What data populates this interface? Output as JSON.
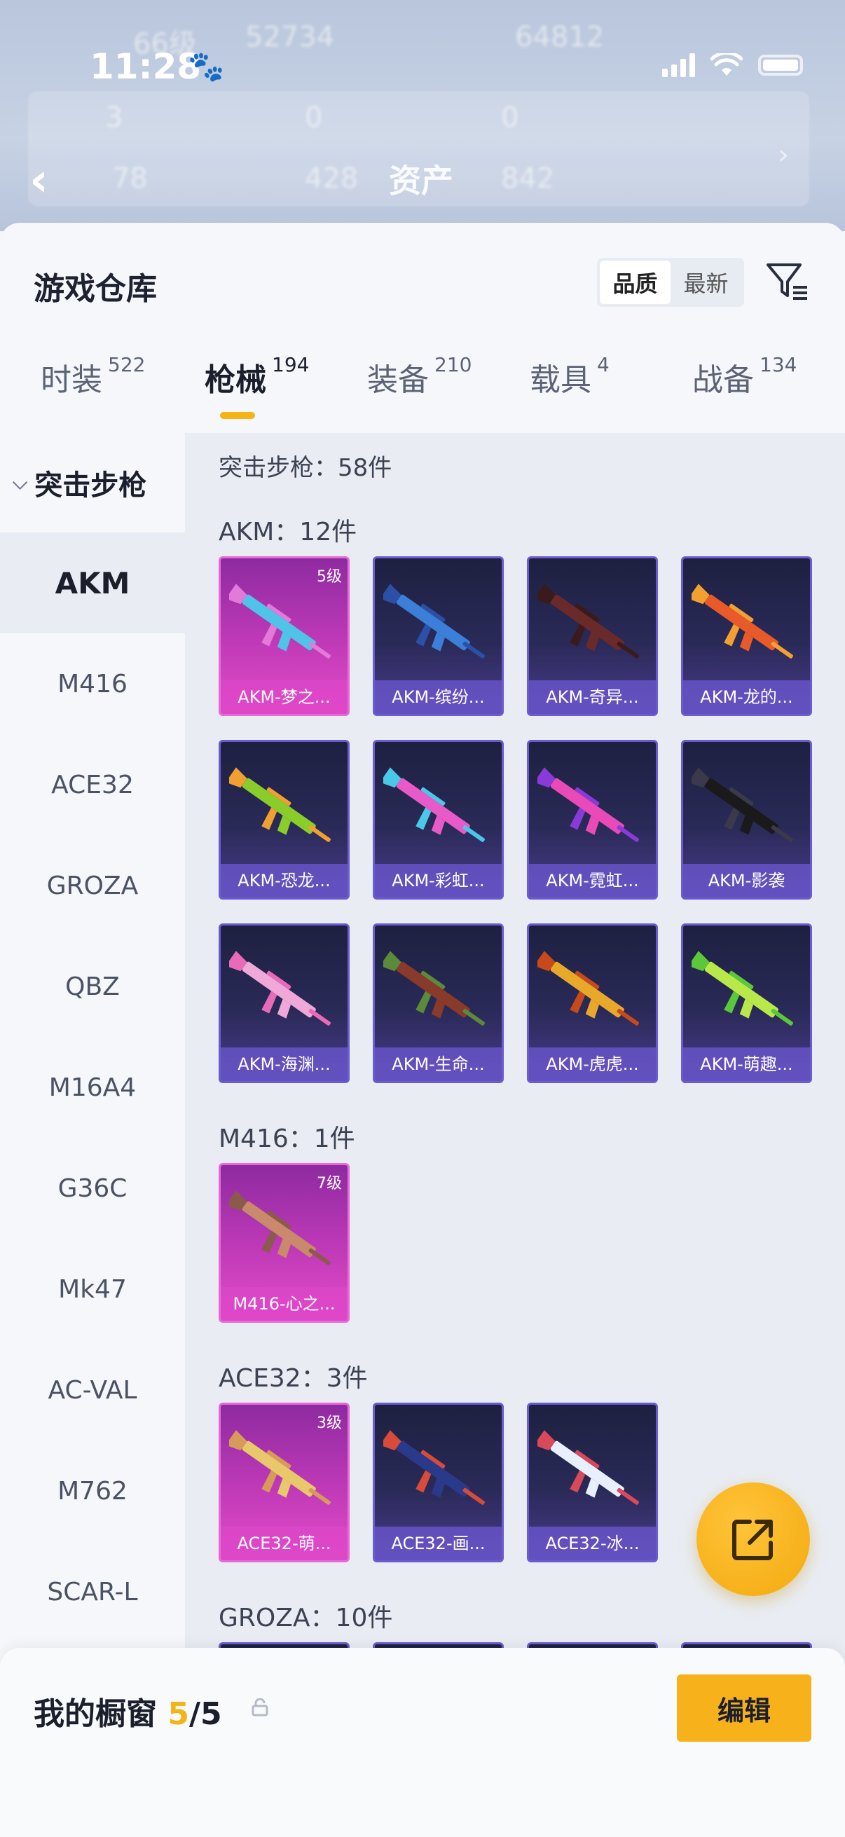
{
  "status_bar": {
    "time": "11:28"
  },
  "header": {
    "title": "资产",
    "ghost_stats": [
      "66级",
      "52734",
      "64812",
      "3",
      "0",
      "0",
      "78",
      "428",
      "842"
    ]
  },
  "sheet": {
    "title": "游戏仓库",
    "sort_options": [
      {
        "label": "品质",
        "active": true
      },
      {
        "label": "最新",
        "active": false
      }
    ]
  },
  "tabs": [
    {
      "label": "时装",
      "count": "522",
      "active": false
    },
    {
      "label": "枪械",
      "count": "194",
      "active": true
    },
    {
      "label": "装备",
      "count": "210",
      "active": false
    },
    {
      "label": "载具",
      "count": "4",
      "active": false
    },
    {
      "label": "战备",
      "count": "134",
      "active": false
    }
  ],
  "sidebar": {
    "group": "突击步枪",
    "items": [
      "AKM",
      "M416",
      "ACE32",
      "GROZA",
      "QBZ",
      "M16A4",
      "G36C",
      "Mk47",
      "AC-VAL",
      "M762",
      "SCAR-L"
    ],
    "active": "AKM"
  },
  "content": {
    "summary": "突击步枪：58件",
    "sections": [
      {
        "title": "AKM：12件",
        "cards": [
          {
            "name": "AKM-梦之...",
            "level": "5级",
            "legend": true
          },
          {
            "name": "AKM-缤纷...",
            "level": "",
            "legend": false
          },
          {
            "name": "AKM-奇异...",
            "level": "",
            "legend": false
          },
          {
            "name": "AKM-龙的...",
            "level": "",
            "legend": false
          },
          {
            "name": "AKM-恐龙...",
            "level": "",
            "legend": false
          },
          {
            "name": "AKM-彩虹...",
            "level": "",
            "legend": false
          },
          {
            "name": "AKM-霓虹...",
            "level": "",
            "legend": false
          },
          {
            "name": "AKM-影袭",
            "level": "",
            "legend": false
          },
          {
            "name": "AKM-海渊...",
            "level": "",
            "legend": false
          },
          {
            "name": "AKM-生命...",
            "level": "",
            "legend": false
          },
          {
            "name": "AKM-虎虎...",
            "level": "",
            "legend": false
          },
          {
            "name": "AKM-萌趣...",
            "level": "",
            "legend": false
          }
        ]
      },
      {
        "title": "M416：1件",
        "cards": [
          {
            "name": "M416-心之...",
            "level": "7级",
            "legend": true
          }
        ]
      },
      {
        "title": "ACE32：3件",
        "cards": [
          {
            "name": "ACE32-萌...",
            "level": "3级",
            "legend": true
          },
          {
            "name": "ACE32-画...",
            "level": "",
            "legend": false
          },
          {
            "name": "ACE32-冰...",
            "level": "",
            "legend": false
          }
        ]
      },
      {
        "title": "GROZA：10件",
        "cards": []
      }
    ]
  },
  "bottom_bar": {
    "label": "我的橱窗",
    "count_current": "5",
    "count_total": "/5",
    "edit_label": "编辑"
  },
  "colors": {
    "accent": "#f5b315",
    "legend_card": "#c03ab8",
    "epic_card": "#4a3c8c"
  }
}
